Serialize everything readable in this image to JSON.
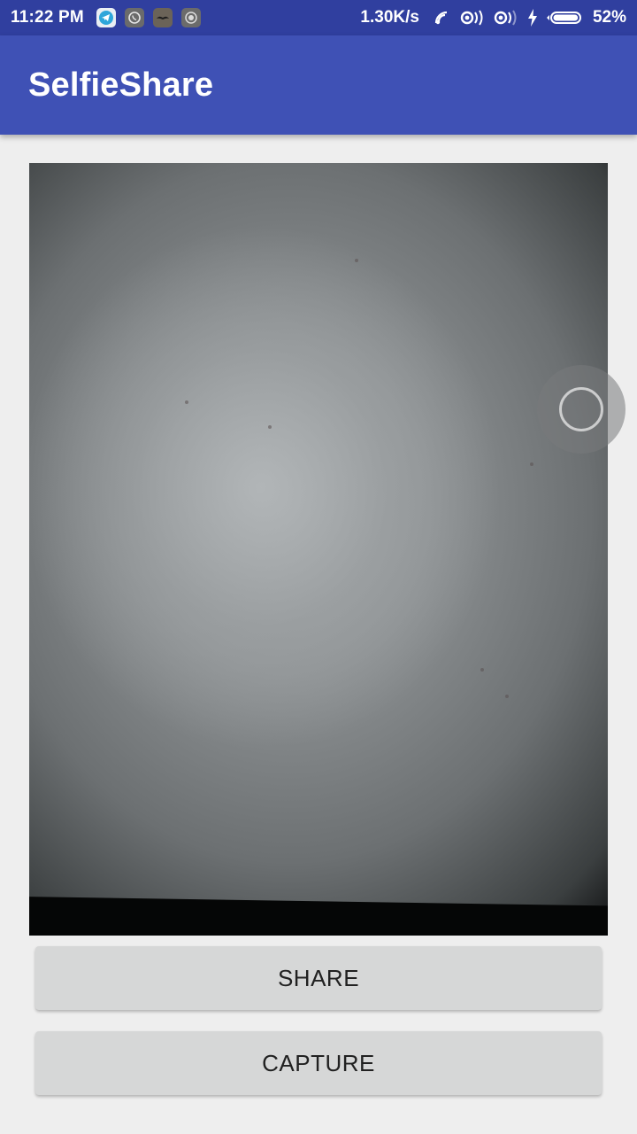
{
  "status_bar": {
    "time": "11:22 PM",
    "network_speed": "1.30K/s",
    "battery_percent": "52%",
    "battery_level": 0.52,
    "notification_icons": [
      "telegram-icon",
      "whatsapp-icon",
      "mustache-app-icon",
      "camera-app-icon"
    ],
    "system_icons": [
      "wifi-icon",
      "signal-1-icon",
      "signal-2-icon",
      "charging-icon",
      "battery-icon"
    ]
  },
  "app_bar": {
    "title": "SelfieShare",
    "color": "#3f51b5",
    "status_color": "#303f9f"
  },
  "preview": {
    "content": "camera-preview"
  },
  "buttons": {
    "share_label": "SHARE",
    "capture_label": "CAPTURE"
  },
  "colors": {
    "background": "#eeeeee",
    "button_bg": "#d6d7d7",
    "button_text": "#212121"
  }
}
